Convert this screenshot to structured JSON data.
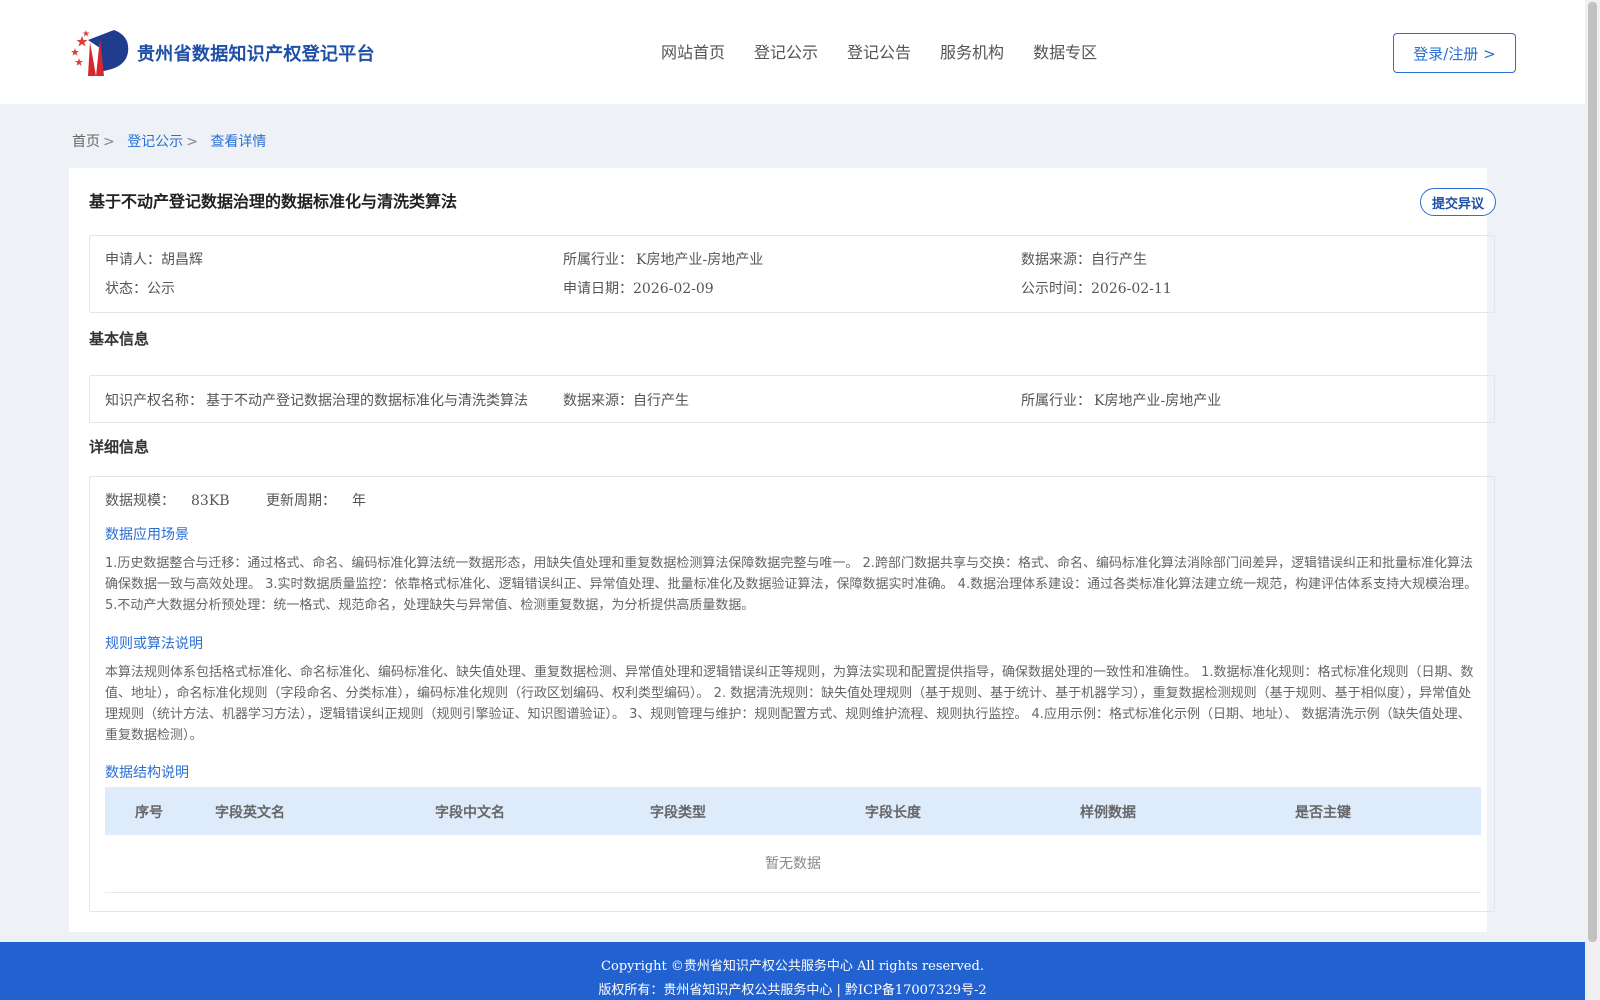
{
  "header": {
    "site_title": "贵州省数据知识产权登记平台",
    "nav": [
      "网站首页",
      "登记公示",
      "登记公告",
      "服务机构",
      "数据专区"
    ],
    "login_label": "登录/注册 >"
  },
  "breadcrumb": {
    "home": "首页",
    "sep": ">",
    "level1": "登记公示",
    "current": "查看详情"
  },
  "record": {
    "title": "基于不动产登记数据治理的数据标准化与清洗类算法",
    "objection_label": "提交异议",
    "summary": {
      "applicant_label": "申请人：",
      "applicant": "胡昌辉",
      "industry_label": "所属行业：",
      "industry": "K房地产业-房地产业",
      "source_label": "数据来源：",
      "source": "自行产生",
      "status_label": "状态：",
      "status": "公示",
      "apply_date_label": "申请日期：",
      "apply_date": "2026-02-09",
      "publish_date_label": "公示时间：",
      "publish_date": "2026-02-11"
    }
  },
  "basic": {
    "section_title": "基本信息",
    "ip_name_label": "知识产权名称：",
    "ip_name": "基于不动产登记数据治理的数据标准化与清洗类算法",
    "source_label": "数据来源：",
    "source": "自行产生",
    "industry_label": "所属行业：",
    "industry": "K房地产业-房地产业"
  },
  "detail": {
    "section_title": "详细信息",
    "scale_label": "数据规模：",
    "scale": "83KB",
    "cycle_label": "更新周期：",
    "cycle": "年",
    "scenario_title": "数据应用场景",
    "scenario_text": "1.历史数据整合与迁移：通过格式、命名、编码标准化算法统一数据形态，用缺失值处理和重复数据检测算法保障数据完整与唯一。 2.跨部门数据共享与交换：格式、命名、编码标准化算法消除部门间差异，逻辑错误纠正和批量标准化算法确保数据一致与高效处理。 3.实时数据质量监控：依靠格式标准化、逻辑错误纠正、异常值处理、批量标准化及数据验证算法，保障数据实时准确。 4.数据治理体系建设：通过各类标准化算法建立统一规范，构建评估体系支持大规模治理。 5.不动产大数据分析预处理：统一格式、规范命名，处理缺失与异常值、检测重复数据，为分析提供高质量数据。",
    "rules_title": "规则或算法说明",
    "rules_text": "本算法规则体系包括格式标准化、命名标准化、编码标准化、缺失值处理、重复数据检测、异常值处理和逻辑错误纠正等规则，为算法实现和配置提供指导，确保数据处理的一致性和准确性。 1.数据标准化规则：格式标准化规则（日期、数值、地址），命名标准化规则（字段命名、分类标准），编码标准化规则（行政区划编码、权利类型编码）。 2. 数据清洗规则：缺失值处理规则（基于规则、基于统计、基于机器学习），重复数据检测规则（基于规则、基于相似度），异常值处理规则（统计方法、机器学习方法），逻辑错误纠正规则（规则引擎验证、知识图谱验证）。 3、规则管理与维护：规则配置方式、规则维护流程、规则执行监控。 4.应用示例：格式标准化示例（日期、地址）、 数据清洗示例（缺失值处理、重复数据检测）。",
    "structure_title": "数据结构说明",
    "table_headers": [
      "序号",
      "字段英文名",
      "字段中文名",
      "字段类型",
      "字段长度",
      "样例数据",
      "是否主键"
    ],
    "empty_text": "暂无数据"
  },
  "footer": {
    "copyright": "Copyright ©贵州省知识产权公共服务中心 All rights reserved.",
    "owner": "版权所有：贵州省知识产权公共服务中心 | 黔ICP备17007329号-2"
  },
  "colors": {
    "primary": "#2a6fd3",
    "footer_bg": "#2262d0",
    "table_head_bg": "#deebfb"
  }
}
